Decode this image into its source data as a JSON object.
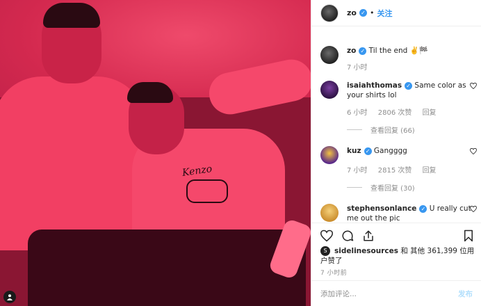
{
  "header": {
    "username": "zo",
    "separator": "•",
    "follow_label": "关注"
  },
  "comments": [
    {
      "username": "zo",
      "text": "Til the end ✌️🏁",
      "time": "7 小时",
      "likes": "",
      "reply": ""
    },
    {
      "username": "isaiahthomas",
      "text": "Same color as your shirts lol",
      "time": "6 小时",
      "likes": "2806 次赞",
      "reply": "回复",
      "view_replies": "查看回复 (66)"
    },
    {
      "username": "kuz",
      "text": "Gangggg",
      "time": "7 小时",
      "likes": "2815 次赞",
      "reply": "回复",
      "view_replies": "查看回复 (30)"
    },
    {
      "username": "stephensonlance",
      "text": "U really cut me out the pic",
      "time": "",
      "likes": "",
      "reply": ""
    }
  ],
  "likes": {
    "username": "sidelinesources",
    "rest": "和 其他 361,399 位用户赞了"
  },
  "timestamp": "7 小时前",
  "add_comment": {
    "placeholder": "添加评论...",
    "post_label": "发布"
  },
  "photo": {
    "shirt_text": "Kenzo"
  },
  "colors": {
    "accent": "#3897f0",
    "photo_tint": "#d22a4f"
  }
}
